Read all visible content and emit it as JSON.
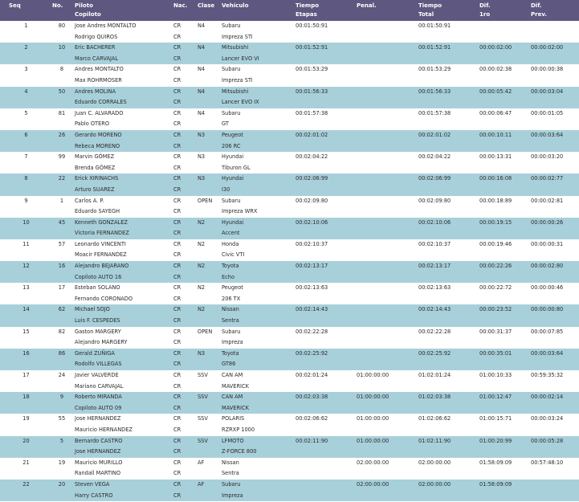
{
  "headers": {
    "seq": [
      "Seq",
      ""
    ],
    "no": [
      "No.",
      ""
    ],
    "piloto": [
      "Piloto",
      "Copiloto"
    ],
    "nac": [
      "Nac.",
      ""
    ],
    "clase": [
      "Clase",
      ""
    ],
    "vehiculo": [
      "Vehículo",
      ""
    ],
    "tiempo_etapas": [
      "Tiempo",
      "Etapas"
    ],
    "penal": [
      "Penal.",
      ""
    ],
    "tiempo_total": [
      "Tiempo",
      "Total"
    ],
    "dif_1ro": [
      "Dif.",
      "1ro"
    ],
    "dif_prev": [
      "Dif.",
      "Prev."
    ]
  },
  "rows": [
    {
      "seq": "1",
      "no": "80",
      "piloto": "Jose Andres MONTALTO",
      "copiloto": "Rodrigo QUIROS",
      "nac1": "CR",
      "nac2": "CR",
      "clase": "N4",
      "veh1": "Subaru",
      "veh2": "Impreza STi",
      "etapas": "00:01:50:91",
      "penal": "",
      "total": "00:01:50:91",
      "dif1": "",
      "difp": ""
    },
    {
      "seq": "2",
      "no": "10",
      "piloto": "Eric BACHERER",
      "copiloto": "Marco CARVAJAL",
      "nac1": "CR",
      "nac2": "CR",
      "clase": "N4",
      "veh1": "Mitsubishi",
      "veh2": "Lancer EVO VI",
      "etapas": "00:01:52:91",
      "penal": "",
      "total": "00:01:52:91",
      "dif1": "00:00:02:00",
      "difp": "00:00:02:00"
    },
    {
      "seq": "3",
      "no": "8",
      "piloto": "Andres MONTALTO",
      "copiloto": "Max ROHRMOSER",
      "nac1": "CR",
      "nac2": "CR",
      "clase": "N4",
      "veh1": "Subaru",
      "veh2": "Impreza STi",
      "etapas": "00:01:53:29",
      "penal": "",
      "total": "00:01:53:29",
      "dif1": "00:00:02:38",
      "difp": "00:00:00:38"
    },
    {
      "seq": "4",
      "no": "50",
      "piloto": "Andres MOLINA",
      "copiloto": "Eduardo CORRALES",
      "nac1": "CR",
      "nac2": "CR",
      "clase": "N4",
      "veh1": "Mitsubishi",
      "veh2": "Lancer EVO IX",
      "etapas": "00:01:56:33",
      "penal": "",
      "total": "00:01:56:33",
      "dif1": "00:00:05:42",
      "difp": "00:00:03:04"
    },
    {
      "seq": "5",
      "no": "81",
      "piloto": "Juan C. ALVARADO",
      "copiloto": "Pablo OTERO",
      "nac1": "CR",
      "nac2": "CR",
      "clase": "N4",
      "veh1": "Subaru",
      "veh2": "GT",
      "etapas": "00:01:57:38",
      "penal": "",
      "total": "00:01:57:38",
      "dif1": "00:00:06:47",
      "difp": "00:00:01:05"
    },
    {
      "seq": "6",
      "no": "26",
      "piloto": "Gerardo MORENO",
      "copiloto": "Rebeca MORENO",
      "nac1": "CR",
      "nac2": "CR",
      "clase": "N3",
      "veh1": "Peugeot",
      "veh2": "206 RC",
      "etapas": "00:02:01:02",
      "penal": "",
      "total": "00:02:01:02",
      "dif1": "00:00:10:11",
      "difp": "00:00:03:64"
    },
    {
      "seq": "7",
      "no": "99",
      "piloto": "Marvin GÓMEZ",
      "copiloto": "Brenda GÓMEZ",
      "nac1": "CR",
      "nac2": "CR",
      "clase": "N3",
      "veh1": "Hyundai",
      "veh2": "Tiburon GL",
      "etapas": "00:02:04:22",
      "penal": "",
      "total": "00:02:04:22",
      "dif1": "00:00:13:31",
      "difp": "00:00:03:20"
    },
    {
      "seq": "8",
      "no": "22",
      "piloto": "Erick XIRINACHS",
      "copiloto": "Arturo SUAREZ",
      "nac1": "CR",
      "nac2": "CR",
      "clase": "N3",
      "veh1": "Hyundai",
      "veh2": "I30",
      "etapas": "00:02:06:99",
      "penal": "",
      "total": "00:02:06:99",
      "dif1": "00:00:16:08",
      "difp": "00:00:02:77"
    },
    {
      "seq": "9",
      "no": "1",
      "piloto": "Carlos A. P.",
      "copiloto": "Eduardo SAYEGH",
      "nac1": "CR",
      "nac2": "CR",
      "clase": "OPEN",
      "veh1": "Subaru",
      "veh2": "Impreza WRX",
      "etapas": "00:02:09:80",
      "penal": "",
      "total": "00:02:09:80",
      "dif1": "00:00:18:89",
      "difp": "00:00:02:81"
    },
    {
      "seq": "10",
      "no": "45",
      "piloto": "Kenneth GONZALEZ",
      "copiloto": "Victoria FERNANDEZ",
      "nac1": "CR",
      "nac2": "CR",
      "clase": "N2",
      "veh1": "Hyundai",
      "veh2": "Accent",
      "etapas": "00:02:10:06",
      "penal": "",
      "total": "00:02:10:06",
      "dif1": "00:00:19:15",
      "difp": "00:00:00:26"
    },
    {
      "seq": "11",
      "no": "57",
      "piloto": "Leonardo VINCENTI",
      "copiloto": "Moacir FERNANDEZ",
      "nac1": "CR",
      "nac2": "CR",
      "clase": "N2",
      "veh1": "Honda",
      "veh2": "Civic VTI",
      "etapas": "00:02:10:37",
      "penal": "",
      "total": "00:02:10:37",
      "dif1": "00:00:19:46",
      "difp": "00:00:00:31"
    },
    {
      "seq": "12",
      "no": "16",
      "piloto": "Alejandro BEJARANO",
      "copiloto": "Copiloto AUTO 16",
      "nac1": "CR",
      "nac2": "CR",
      "clase": "N2",
      "veh1": "Toyota",
      "veh2": "Echo",
      "etapas": "00:02:13:17",
      "penal": "",
      "total": "00:02:13:17",
      "dif1": "00:00:22:26",
      "difp": "00:00:02:80"
    },
    {
      "seq": "13",
      "no": "17",
      "piloto": "Esteban SOLANO",
      "copiloto": "Fernando CORONADO",
      "nac1": "CR",
      "nac2": "CR",
      "clase": "N2",
      "veh1": "Peugeot",
      "veh2": "206 TX",
      "etapas": "00:02:13:63",
      "penal": "",
      "total": "00:02:13:63",
      "dif1": "00:00:22:72",
      "difp": "00:00:00:46"
    },
    {
      "seq": "14",
      "no": "62",
      "piloto": "Michael SOJO",
      "copiloto": "Luis F. CESPEDES",
      "nac1": "CR",
      "nac2": "CR",
      "clase": "N2",
      "veh1": "Nissan",
      "veh2": "Sentra",
      "etapas": "00:02:14:43",
      "penal": "",
      "total": "00:02:14:43",
      "dif1": "00:00:23:52",
      "difp": "00:00:00:80"
    },
    {
      "seq": "15",
      "no": "82",
      "piloto": "Gaston MARGERY",
      "copiloto": "Alejandro MARGERY",
      "nac1": "CR",
      "nac2": "CR",
      "clase": "OPEN",
      "veh1": "Subaru",
      "veh2": "Impreza",
      "etapas": "00:02:22:28",
      "penal": "",
      "total": "00:02:22:28",
      "dif1": "00:00:31:37",
      "difp": "00:00:07:85"
    },
    {
      "seq": "16",
      "no": "86",
      "piloto": "Gerald ZUÑIGA",
      "copiloto": "Rodolfo VILLEGAS",
      "nac1": "CR",
      "nac2": "CR",
      "clase": "N3",
      "veh1": "Toyota",
      "veh2": "GT86",
      "etapas": "00:02:25:92",
      "penal": "",
      "total": "00:02:25:92",
      "dif1": "00:00:35:01",
      "difp": "00:00:03:64"
    },
    {
      "seq": "17",
      "no": "24",
      "piloto": "Javier VALVERDE",
      "copiloto": "Mariano CARVAJAL",
      "nac1": "CR",
      "nac2": "CR",
      "clase": "SSV",
      "veh1": "CAN AM",
      "veh2": "MAVERICK",
      "etapas": "00:02:01:24",
      "penal": "01:00:00:00",
      "total": "01:02:01:24",
      "dif1": "01:00:10:33",
      "difp": "00:59:35:32"
    },
    {
      "seq": "18",
      "no": "9",
      "piloto": "Roberto MIRANDA",
      "copiloto": "Copiloto AUTO 09",
      "nac1": "CR",
      "nac2": "CR",
      "clase": "SSV",
      "veh1": "CAN AM",
      "veh2": "MAVERICK",
      "etapas": "00:02:03:38",
      "penal": "01:00:00:00",
      "total": "01:02:03:38",
      "dif1": "01:00:12:47",
      "difp": "00:00:02:14"
    },
    {
      "seq": "19",
      "no": "55",
      "piloto": "Jose HERNANDEZ",
      "copiloto": "Mauricio HERNANDEZ",
      "nac1": "CR",
      "nac2": "CR",
      "clase": "SSV",
      "veh1": "POLARIS",
      "veh2": "RZRXP 1000",
      "etapas": "00:02:06:62",
      "penal": "01:00:00:00",
      "total": "01:02:06:62",
      "dif1": "01:00:15:71",
      "difp": "00:00:03:24"
    },
    {
      "seq": "20",
      "no": "5",
      "piloto": "Bernardo CASTRO",
      "copiloto": "Jose HERNANDEZ",
      "nac1": "CR",
      "nac2": "CR",
      "clase": "SSV",
      "veh1": "LFMOTO",
      "veh2": "Z-FORCE 800",
      "etapas": "00:02:11:90",
      "penal": "01:00:00:00",
      "total": "01:02:11:90",
      "dif1": "01:00:20:99",
      "difp": "00:00:05:28"
    },
    {
      "seq": "21",
      "no": "19",
      "piloto": "Mauricio MURILLO",
      "copiloto": "Randall MARTINO",
      "nac1": "CR",
      "nac2": "CR",
      "clase": "AF",
      "veh1": "Nissan",
      "veh2": "Sentra",
      "etapas": "",
      "penal": "02:00:00:00",
      "total": "02:00:00:00",
      "dif1": "01:58:09:09",
      "difp": "00:57:48:10"
    },
    {
      "seq": "22",
      "no": "20",
      "piloto": "Steven VEGA",
      "copiloto": "Harry CASTRO",
      "nac1": "CR",
      "nac2": "CR",
      "clase": "AF",
      "veh1": "Subaru",
      "veh2": "Impreza",
      "etapas": "",
      "penal": "02:00:00:00",
      "total": "02:00:00:00",
      "dif1": "01:58:09:09",
      "difp": ""
    }
  ]
}
